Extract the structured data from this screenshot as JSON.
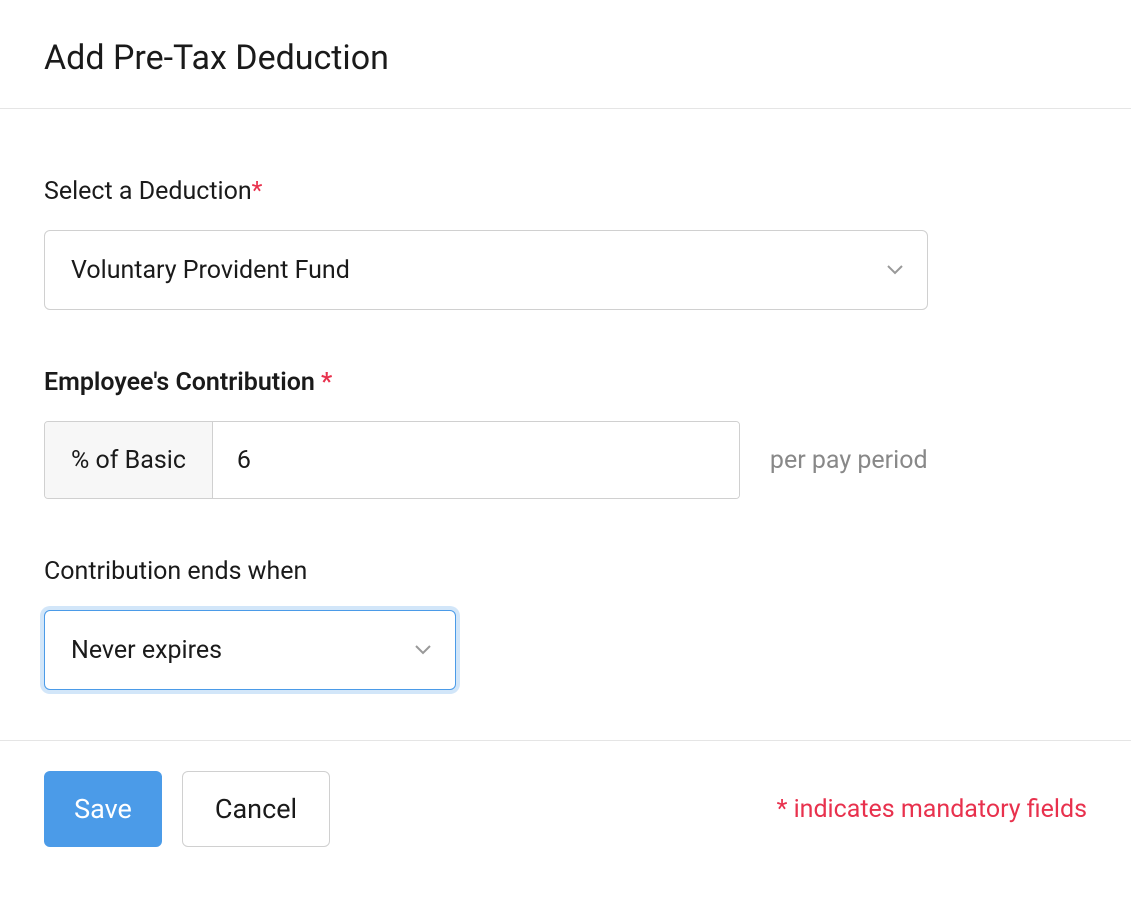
{
  "header": {
    "title": "Add Pre-Tax Deduction"
  },
  "form": {
    "deduction": {
      "label": "Select a Deduction",
      "selected": "Voluntary Provident Fund"
    },
    "contribution": {
      "label": "Employee's Contribution ",
      "unit": "% of Basic",
      "value": "6",
      "hint": "per pay period"
    },
    "ends": {
      "label": "Contribution ends when",
      "selected": "Never expires"
    }
  },
  "footer": {
    "save": "Save",
    "cancel": "Cancel",
    "mandatory_note": "* indicates mandatory fields"
  },
  "required_mark": "*"
}
